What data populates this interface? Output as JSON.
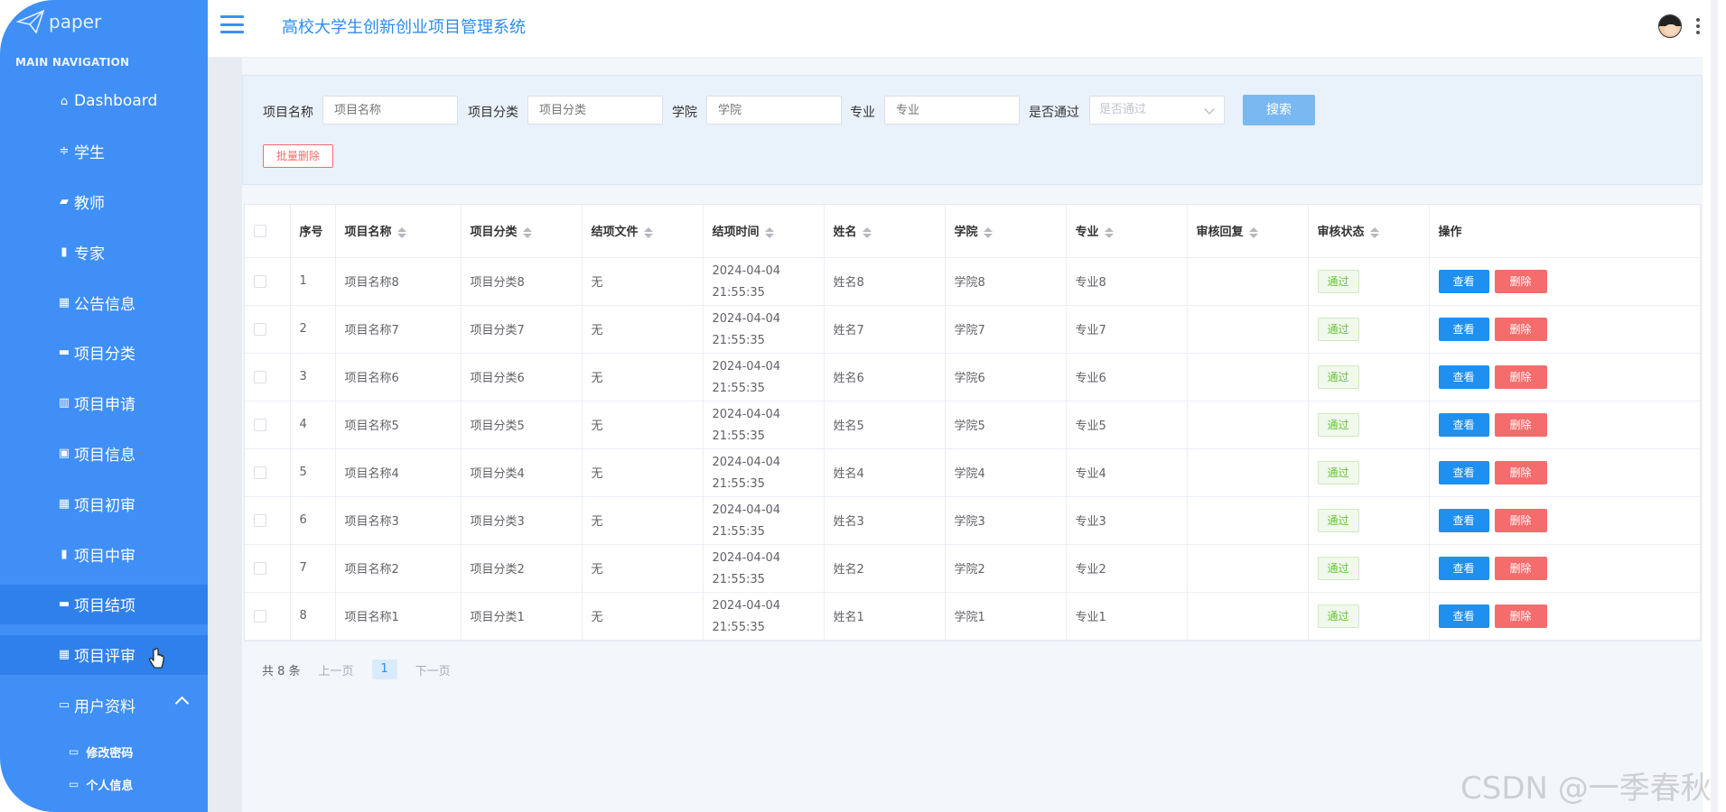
{
  "logo": {
    "text": "paper"
  },
  "sidebar": {
    "heading": "MAIN NAVIGATION",
    "items": [
      {
        "label": "Dashboard",
        "icon": "home-icon"
      },
      {
        "label": "学生",
        "icon": "sliders-icon"
      },
      {
        "label": "教师",
        "icon": "thumbs-icon"
      },
      {
        "label": "专家",
        "icon": "clipboard-icon"
      },
      {
        "label": "公告信息",
        "icon": "grid-icon"
      },
      {
        "label": "项目分类",
        "icon": "chat-icon"
      },
      {
        "label": "项目申请",
        "icon": "bar-chart-icon"
      },
      {
        "label": "项目信息",
        "icon": "briefcase-icon"
      },
      {
        "label": "项目初审",
        "icon": "grid-icon"
      },
      {
        "label": "项目中审",
        "icon": "clipboard-icon"
      },
      {
        "label": "项目结项",
        "icon": "monitor-icon"
      },
      {
        "label": "项目评审",
        "icon": "grid-icon"
      },
      {
        "label": "用户资料",
        "icon": "card-icon"
      }
    ],
    "sub_items": [
      {
        "label": "修改密码",
        "icon": "folder-icon"
      },
      {
        "label": "个人信息",
        "icon": "folder-icon"
      }
    ]
  },
  "header": {
    "title": "高校大学生创新创业项目管理系统"
  },
  "filters": {
    "name_label": "项目名称",
    "name_placeholder": "项目名称",
    "category_label": "项目分类",
    "category_placeholder": "项目分类",
    "college_label": "学院",
    "college_placeholder": "学院",
    "major_label": "专业",
    "major_placeholder": "专业",
    "passed_label": "是否通过",
    "passed_placeholder": "是否通过",
    "search_label": "搜索",
    "batch_delete_label": "批量删除"
  },
  "table": {
    "headers": [
      "序号",
      "项目名称",
      "项目分类",
      "结项文件",
      "结项时间",
      "姓名",
      "学院",
      "专业",
      "审核回复",
      "审核状态",
      "操作"
    ],
    "rows": [
      {
        "idx": "1",
        "name": "项目名称8",
        "cat": "项目分类8",
        "file": "无",
        "time": "2024-04-04 21:55:35",
        "person": "姓名8",
        "college": "学院8",
        "major": "专业8",
        "reply": "",
        "status": "通过"
      },
      {
        "idx": "2",
        "name": "项目名称7",
        "cat": "项目分类7",
        "file": "无",
        "time": "2024-04-04 21:55:35",
        "person": "姓名7",
        "college": "学院7",
        "major": "专业7",
        "reply": "",
        "status": "通过"
      },
      {
        "idx": "3",
        "name": "项目名称6",
        "cat": "项目分类6",
        "file": "无",
        "time": "2024-04-04 21:55:35",
        "person": "姓名6",
        "college": "学院6",
        "major": "专业6",
        "reply": "",
        "status": "通过"
      },
      {
        "idx": "4",
        "name": "项目名称5",
        "cat": "项目分类5",
        "file": "无",
        "time": "2024-04-04 21:55:35",
        "person": "姓名5",
        "college": "学院5",
        "major": "专业5",
        "reply": "",
        "status": "通过"
      },
      {
        "idx": "5",
        "name": "项目名称4",
        "cat": "项目分类4",
        "file": "无",
        "time": "2024-04-04 21:55:35",
        "person": "姓名4",
        "college": "学院4",
        "major": "专业4",
        "reply": "",
        "status": "通过"
      },
      {
        "idx": "6",
        "name": "项目名称3",
        "cat": "项目分类3",
        "file": "无",
        "time": "2024-04-04 21:55:35",
        "person": "姓名3",
        "college": "学院3",
        "major": "专业3",
        "reply": "",
        "status": "通过"
      },
      {
        "idx": "7",
        "name": "项目名称2",
        "cat": "项目分类2",
        "file": "无",
        "time": "2024-04-04 21:55:35",
        "person": "姓名2",
        "college": "学院2",
        "major": "专业2",
        "reply": "",
        "status": "通过"
      },
      {
        "idx": "8",
        "name": "项目名称1",
        "cat": "项目分类1",
        "file": "无",
        "time": "2024-04-04 21:55:35",
        "person": "姓名1",
        "college": "学院1",
        "major": "专业1",
        "reply": "",
        "status": "通过"
      }
    ],
    "view_label": "查看",
    "delete_label": "删除"
  },
  "pagination": {
    "total": "共 8 条",
    "prev": "上一页",
    "current": "1",
    "next": "下一页"
  },
  "watermark": "CSDN @一季春秋",
  "colors": {
    "sidebar": "#3f8ff7",
    "active": "#2f80ea",
    "primary": "#1f8ff0",
    "danger": "#f56c6c",
    "success": "#67c23a"
  }
}
